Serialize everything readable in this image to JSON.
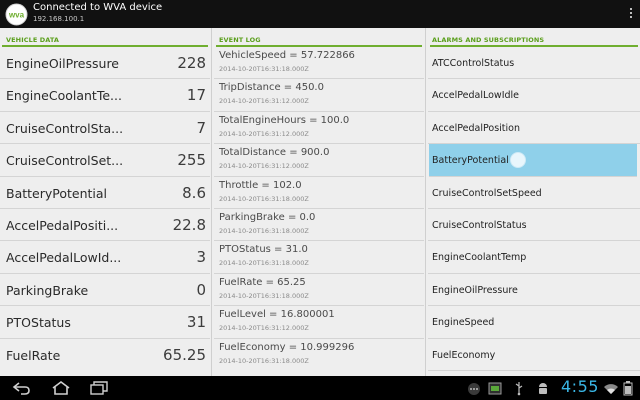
{
  "app": {
    "title": "Connected to WVA device",
    "subtitle": "192.168.100.1",
    "logo_text": "wva"
  },
  "columns": {
    "vehicle": "VEHICLE DATA",
    "event": "EVENT LOG",
    "alarms": "ALARMS AND SUBSCRIPTIONS"
  },
  "vehicle_data": [
    {
      "name": "EngineOilPressure",
      "value": "228"
    },
    {
      "name": "EngineCoolantTe...",
      "value": "17"
    },
    {
      "name": "CruiseControlSta...",
      "value": "7"
    },
    {
      "name": "CruiseControlSet...",
      "value": "255"
    },
    {
      "name": "BatteryPotential",
      "value": "8.6"
    },
    {
      "name": "AccelPedalPositi...",
      "value": "22.8"
    },
    {
      "name": "AccelPedalLowId...",
      "value": "3"
    },
    {
      "name": "ParkingBrake",
      "value": "0"
    },
    {
      "name": "PTOStatus",
      "value": "31"
    },
    {
      "name": "FuelRate",
      "value": "65.25"
    }
  ],
  "event_log": [
    {
      "text": "VehicleSpeed = 57.722866",
      "time": "2014-10-20T16:31:18.000Z"
    },
    {
      "text": "TripDistance = 450.0",
      "time": "2014-10-20T16:31:12.000Z"
    },
    {
      "text": "TotalEngineHours = 100.0",
      "time": "2014-10-20T16:31:12.000Z"
    },
    {
      "text": "TotalDistance = 900.0",
      "time": "2014-10-20T16:31:12.000Z"
    },
    {
      "text": "Throttle = 102.0",
      "time": "2014-10-20T16:31:18.000Z"
    },
    {
      "text": "ParkingBrake = 0.0",
      "time": "2014-10-20T16:31:18.000Z"
    },
    {
      "text": "PTOStatus = 31.0",
      "time": "2014-10-20T16:31:18.000Z"
    },
    {
      "text": "FuelRate = 65.25",
      "time": "2014-10-20T16:31:18.000Z"
    },
    {
      "text": "FuelLevel = 16.800001",
      "time": "2014-10-20T16:31:12.000Z"
    },
    {
      "text": "FuelEconomy = 10.999296",
      "time": "2014-10-20T16:31:18.000Z"
    }
  ],
  "alarms": [
    {
      "name": "ATCControlStatus"
    },
    {
      "name": "AccelPedalLowIdle"
    },
    {
      "name": "AccelPedalPosition"
    },
    {
      "name": "BatteryPotential",
      "selected": true
    },
    {
      "name": "CruiseControlSetSpeed"
    },
    {
      "name": "CruiseControlStatus"
    },
    {
      "name": "EngineCoolantTemp"
    },
    {
      "name": "EngineOilPressure"
    },
    {
      "name": "EngineSpeed"
    },
    {
      "name": "FuelEconomy"
    }
  ],
  "status_bar": {
    "clock": "4:55"
  },
  "colors": {
    "accent": "#6fae2f",
    "selection": "#8fd0ea",
    "clock": "#3ab7e6"
  }
}
